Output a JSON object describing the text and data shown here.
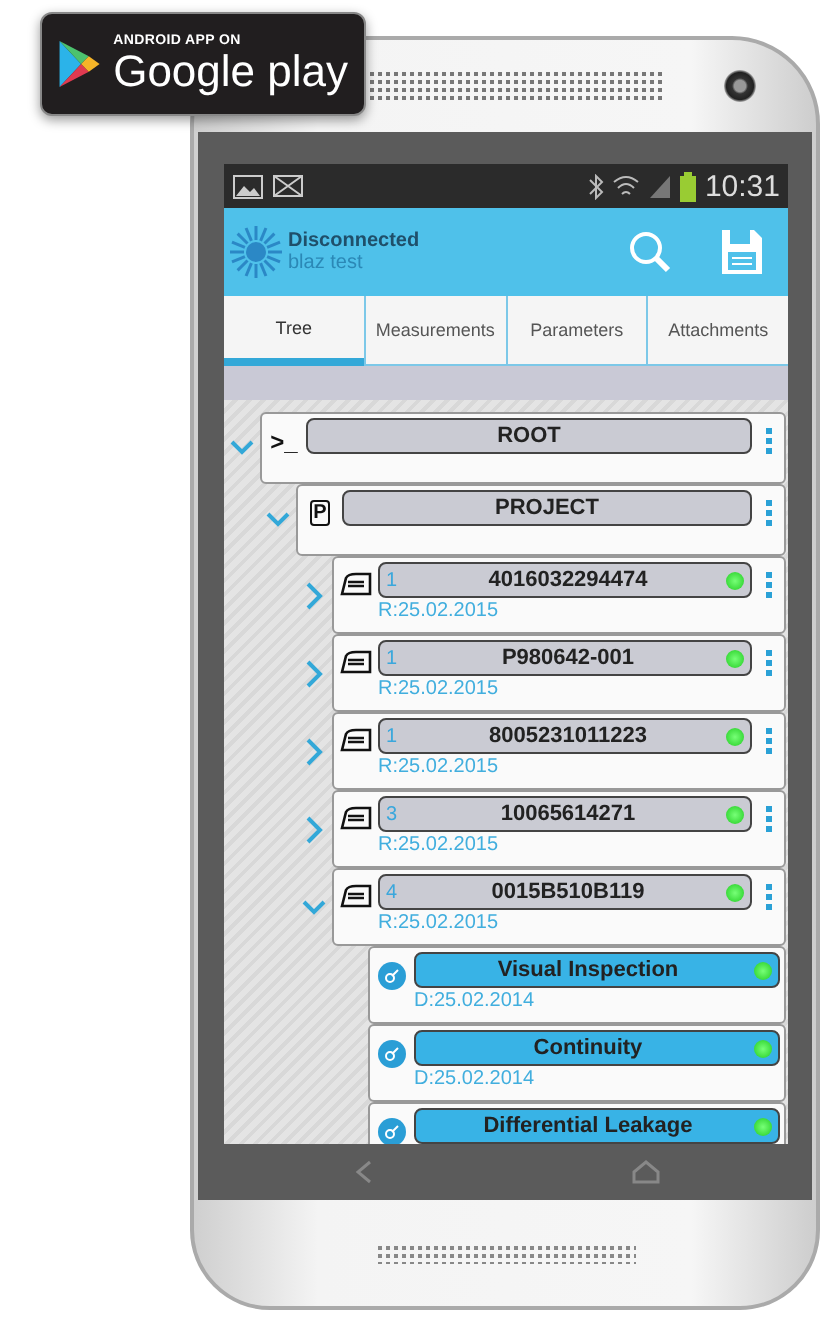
{
  "store_badge": {
    "caption": "ANDROID APP ON",
    "name": "Google play"
  },
  "status_bar": {
    "time": "10:31"
  },
  "action_bar": {
    "title": "Disconnected",
    "subtitle": "blaz test"
  },
  "tabs": [
    {
      "label": "Tree",
      "selected": true
    },
    {
      "label": "Measurements",
      "selected": false
    },
    {
      "label": "Parameters",
      "selected": false
    },
    {
      "label": "Attachments",
      "selected": false
    }
  ],
  "tree": {
    "kind": "root",
    "icon_text": ">_",
    "label": "ROOT",
    "expanded": true,
    "children": [
      {
        "kind": "project",
        "icon_text": "P",
        "label": "PROJECT",
        "expanded": true,
        "children": [
          {
            "kind": "device",
            "index": "1",
            "label": "4016032294474",
            "date": "R:25.02.2015",
            "expanded": false
          },
          {
            "kind": "device",
            "index": "1",
            "label": "P980642-001",
            "date": "R:25.02.2015",
            "expanded": false
          },
          {
            "kind": "device",
            "index": "1",
            "label": "8005231011223",
            "date": "R:25.02.2015",
            "expanded": false
          },
          {
            "kind": "device",
            "index": "3",
            "label": "10065614271",
            "date": "R:25.02.2015",
            "expanded": false
          },
          {
            "kind": "device",
            "index": "4",
            "label": "0015B510B119",
            "date": "R:25.02.2015",
            "expanded": true,
            "children": [
              {
                "kind": "measurement",
                "label": "Visual Inspection",
                "date": "D:25.02.2014"
              },
              {
                "kind": "measurement",
                "label": "Continuity",
                "date": "D:25.02.2014"
              },
              {
                "kind": "measurement",
                "label": "Differential Leakage"
              }
            ]
          }
        ]
      }
    ]
  }
}
